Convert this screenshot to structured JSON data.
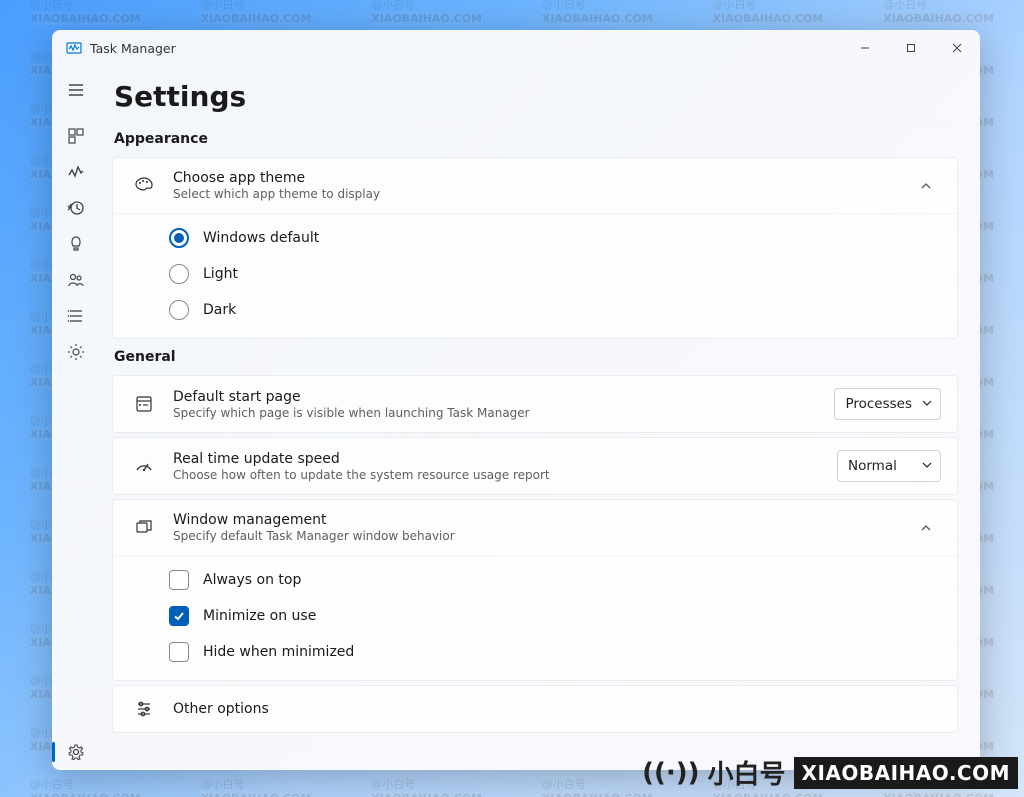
{
  "app": {
    "title": "Task Manager"
  },
  "page": {
    "title": "Settings"
  },
  "sections": {
    "appearance": {
      "header": "Appearance",
      "theme": {
        "title": "Choose app theme",
        "subtitle": "Select which app theme to display",
        "options": {
          "windows_default": "Windows default",
          "light": "Light",
          "dark": "Dark"
        },
        "selected": "windows_default"
      }
    },
    "general": {
      "header": "General",
      "default_page": {
        "title": "Default start page",
        "subtitle": "Specify which page is visible when launching Task Manager",
        "value": "Processes"
      },
      "update_speed": {
        "title": "Real time update speed",
        "subtitle": "Choose how often to update the system resource usage report",
        "value": "Normal"
      },
      "window_mgmt": {
        "title": "Window management",
        "subtitle": "Specify default Task Manager window behavior",
        "options": {
          "always_on_top": {
            "label": "Always on top",
            "checked": false
          },
          "minimize_on_use": {
            "label": "Minimize on use",
            "checked": true
          },
          "hide_when_minimized": {
            "label": "Hide when minimized",
            "checked": false
          }
        }
      },
      "other": {
        "title": "Other options"
      }
    }
  },
  "watermark": {
    "line1": "@小白号",
    "line2": "XIAOBAIHAO.COM"
  },
  "brand": {
    "cn": "小白号",
    "en": "XIAOBAIHAO.COM"
  }
}
